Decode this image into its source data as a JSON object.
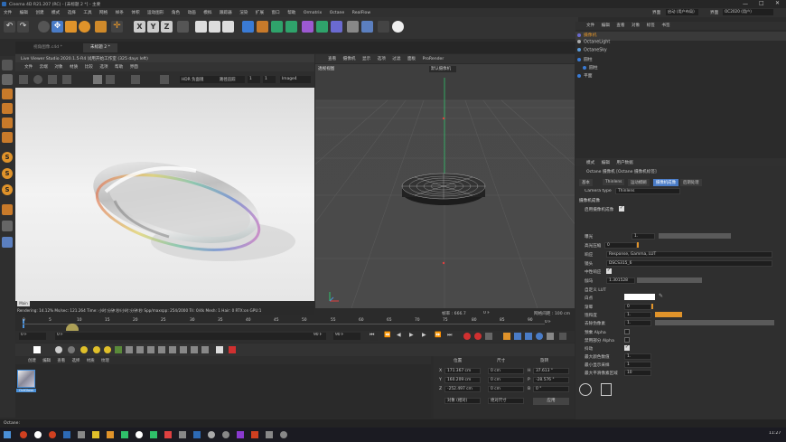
{
  "title": "Cinema 4D R21.207 (RC) - [未标题 2 *] - 主要",
  "menu": [
    "文件",
    "编辑",
    "创建",
    "模式",
    "选择",
    "工具",
    "网格",
    "样条",
    "体积",
    "运动图形",
    "角色",
    "动画",
    "模拟",
    "跟踪器",
    "渲染",
    "扩展",
    "窗口",
    "帮助",
    "Ormatrix",
    "Octane",
    "RealFlow"
  ],
  "interface_label": "界面",
  "interface_value": "启动 (用户布局)",
  "layout_label": "界面",
  "layout_value": "OC2020 (用户)",
  "tabs": [
    "视角图像.c4d *",
    "未标题 2 *"
  ],
  "live_viewer": {
    "title": "Live Viewer Studio 2020.1.5-R4 试用开始工作室 (325 days left)",
    "menu": [
      "文件",
      "云端",
      "对象",
      "材质",
      "比较",
      "选项",
      "帮助",
      "界面"
    ],
    "hdr": "HDR 负面镜",
    "render_mode": "路径追踪",
    "frame": "1",
    "image": "Image4",
    "status_left": "Rendering: 14.12%  Ms/sec: 121.264  Time: 小时:分钟:秒/小时:分钟:秒  Spp/maxspp: 254/2000  Tri: 0/4k  Mesh: 1  Hair: 0  RTX:on  GPU:1",
    "status_badge": "Main"
  },
  "viewport": {
    "menu": [
      "查看",
      "摄像机",
      "显示",
      "选项",
      "过滤",
      "面板",
      "ProRender"
    ],
    "label": "透视视图",
    "camera": "默认摄像机",
    "grid_label": "网格间距 : 100 cm",
    "frame_label": "帧率 : 666.7",
    "frame2": "0 F"
  },
  "timeline": {
    "ticks": [
      "0",
      "5",
      "10",
      "15",
      "20",
      "25",
      "30",
      "35",
      "40",
      "45",
      "50",
      "55",
      "60",
      "65",
      "70",
      "75",
      "80",
      "85",
      "90"
    ],
    "end": "0 F",
    "start": "0 F",
    "fps": "90 F",
    "fps2": "90 F"
  },
  "material_menu": [
    "创建",
    "编辑",
    "查看",
    "选择",
    "材质",
    "纹理"
  ],
  "material_name": "OctGloss",
  "coord": {
    "headers": [
      "位置",
      "尺寸",
      "旋转"
    ],
    "rows": [
      [
        "X",
        "171.367 cm",
        "0 cm",
        "H",
        "37.613 °"
      ],
      [
        "Y",
        "160.209 cm",
        "0 cm",
        "P",
        "-28.576 °"
      ],
      [
        "Z",
        "-252.497 cm",
        "0 cm",
        "B",
        "0 °"
      ]
    ],
    "mode": "对象 (相对)",
    "size_mode": "绝对尺寸",
    "apply": "应用"
  },
  "objects": {
    "menu": [
      "文件",
      "编辑",
      "查看",
      "对象",
      "标签",
      "书签"
    ],
    "items": [
      "摄像机",
      "OctaneLight",
      "OctaneSky",
      "圆柱",
      "圆柱",
      "平面"
    ]
  },
  "attributes": {
    "menu": [
      "模式",
      "编辑",
      "用户数据"
    ],
    "title": "Octane 摄像机 [Octane 摄像机标签]",
    "tabs": [
      "基本",
      "Thinlens",
      "运动模糊",
      "摄像机成像",
      "后期处理"
    ],
    "camera_type_label": "Camera type",
    "camera_type": "Thinlens",
    "section": "摄像机成像",
    "enable": "启用摄像机成像",
    "rows": [
      {
        "label": "曝光",
        "value": "1."
      },
      {
        "label": "高光压缩",
        "value": "0"
      },
      {
        "label": "响应",
        "value": "Response, Gamma, LUT"
      },
      {
        "label": "镜头",
        "value": "DSCS315_6"
      },
      {
        "label": "中性响应",
        "value": ""
      },
      {
        "label": "伽马",
        "value": "1.301528"
      },
      {
        "label": "自定义 LUT",
        "value": ""
      },
      {
        "label": "白点",
        "value": ""
      },
      {
        "label": "渐晕",
        "value": "0"
      },
      {
        "label": "饱和度",
        "value": "1."
      },
      {
        "label": "去除伪像素",
        "value": "1."
      },
      {
        "label": "预乘 Alpha",
        "value": ""
      },
      {
        "label": "禁用部分 Alpha",
        "value": ""
      },
      {
        "label": "抖动",
        "value": ""
      },
      {
        "label": "最大颜色数值",
        "value": "1."
      },
      {
        "label": "最小显示采样",
        "value": "1"
      },
      {
        "label": "最大平滑像素区域",
        "value": "10"
      }
    ]
  },
  "status": "Octane:",
  "clock": "11:27",
  "colors": {
    "accent": "#4a90d9",
    "orange": "#e0932a",
    "bg": "#2b2b2b"
  }
}
